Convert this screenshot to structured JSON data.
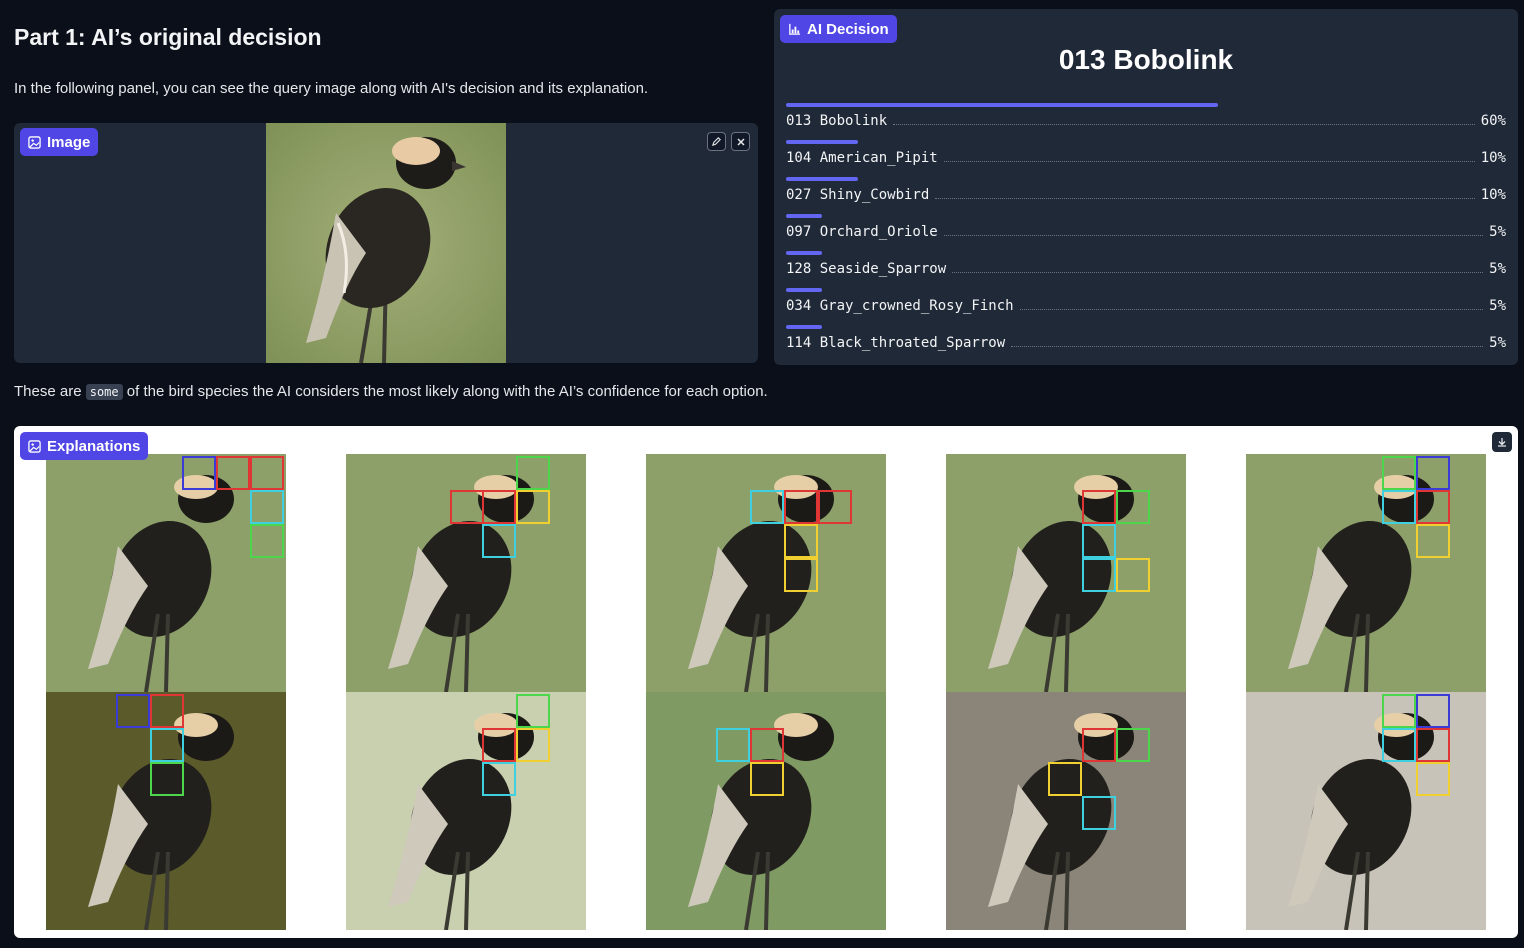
{
  "part": {
    "title": "Part 1: AI’s original decision",
    "intro": "In the following panel, you can see the query image along with AI's decision and its explanation."
  },
  "image_panel": {
    "badge_label": "Image",
    "edit_icon": "pencil-icon",
    "close_icon": "close-icon"
  },
  "decision": {
    "badge_label": "AI Decision",
    "top_label": "013 Bobolink",
    "confidences": [
      {
        "label": "013 Bobolink",
        "value": "60%",
        "fraction": 0.6
      },
      {
        "label": "104 American_Pipit",
        "value": "10%",
        "fraction": 0.1
      },
      {
        "label": "027 Shiny_Cowbird",
        "value": "10%",
        "fraction": 0.1
      },
      {
        "label": "097 Orchard_Oriole",
        "value": "5%",
        "fraction": 0.05
      },
      {
        "label": "128 Seaside_Sparrow",
        "value": "5%",
        "fraction": 0.05
      },
      {
        "label": "034 Gray_crowned_Rosy_Finch",
        "value": "5%",
        "fraction": 0.05
      },
      {
        "label": "114 Black_throated_Sparrow",
        "value": "5%",
        "fraction": 0.05
      }
    ]
  },
  "species_note": {
    "before": "These are ",
    "code": "some",
    "after": " of the bird species the AI considers the most likely along with the AI’s confidence for each option."
  },
  "explanations": {
    "badge_label": "Explanations",
    "download_icon": "download-icon"
  },
  "colors": {
    "accent": "#4f46e5",
    "bar": "#6366f1",
    "box_blue": "#3b3bd6",
    "box_red": "#e03535",
    "box_cyan": "#3fd0e0",
    "box_green": "#4cd64c",
    "box_yellow": "#f0d030"
  }
}
